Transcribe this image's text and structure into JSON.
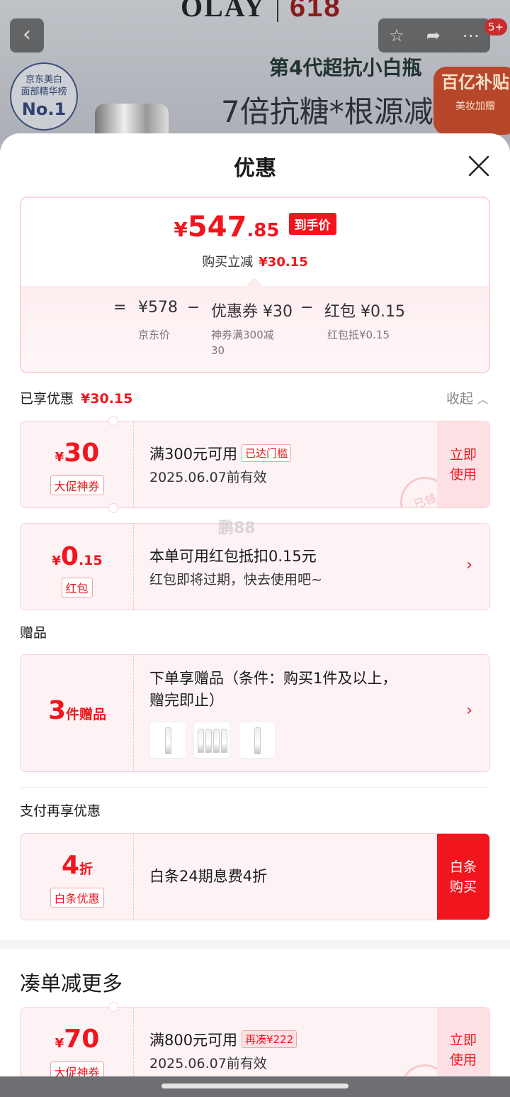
{
  "background": {
    "brand": "OLAY",
    "brand_event": "618",
    "rank_line1": "京东美白",
    "rank_line2": "面部精华榜",
    "rank_badge": "No.1",
    "headline1": "第4代超抗小白瓶",
    "headline2": "7倍抗糖*根源减",
    "subsidy": "百亿补贴",
    "subsidy_note": "美妆加赠",
    "notif_badge": "5+"
  },
  "sheet": {
    "title": "优惠"
  },
  "summary": {
    "currency": "¥",
    "price_int": "547",
    "price_dec": ".85",
    "price_tag": "到手价",
    "saving_label": "购买立减",
    "saving_value": "¥30.15",
    "eq": "=",
    "minus": "−",
    "jd_price": "¥578",
    "jd_price_label": "京东价",
    "coupon": "优惠券 ¥30",
    "coupon_note_1": "神券满300减",
    "coupon_note_2": "30",
    "redpack": "红包 ¥0.15",
    "redpack_note": "红包抵¥0.15"
  },
  "enjoyed": {
    "label": "已享优惠",
    "value": "¥30.15",
    "collapse": "收起"
  },
  "coupon1": {
    "currency": "¥",
    "amount": "30",
    "tag": "大促神券",
    "title": "满300元可用",
    "status": "已达门槛",
    "expiry": "2025.06.07前有效",
    "action": "立即使用",
    "stamp": "已领"
  },
  "redpack": {
    "currency": "¥",
    "amount": "0",
    "decimal": ".15",
    "tag": "红包",
    "title": "本单可用红包抵扣0.15元",
    "desc": "红包即将过期，快去使用吧~"
  },
  "gifts": {
    "section": "赠品",
    "count": "3",
    "count_label": "件赠品",
    "title_1": "下单享赠品（条件：购买1件及以上，",
    "title_2": "赠完即止）"
  },
  "pay": {
    "section": "支付再享优惠",
    "amount": "4",
    "unit": "折",
    "tag": "白条优惠",
    "title": "白条24期息费4折",
    "action": "白条购买"
  },
  "more": {
    "title": "凑单减更多",
    "currency": "¥",
    "amount": "70",
    "tag": "大促神券",
    "cond": "满800元可用",
    "status": "再凑¥222",
    "expiry": "2025.06.07前有效",
    "action": "立即使用"
  },
  "watermark": "鹏88",
  "colors": {
    "accent": "#f2151d",
    "card_bg": "#fdf3f4",
    "border": "#f9d2d6"
  }
}
